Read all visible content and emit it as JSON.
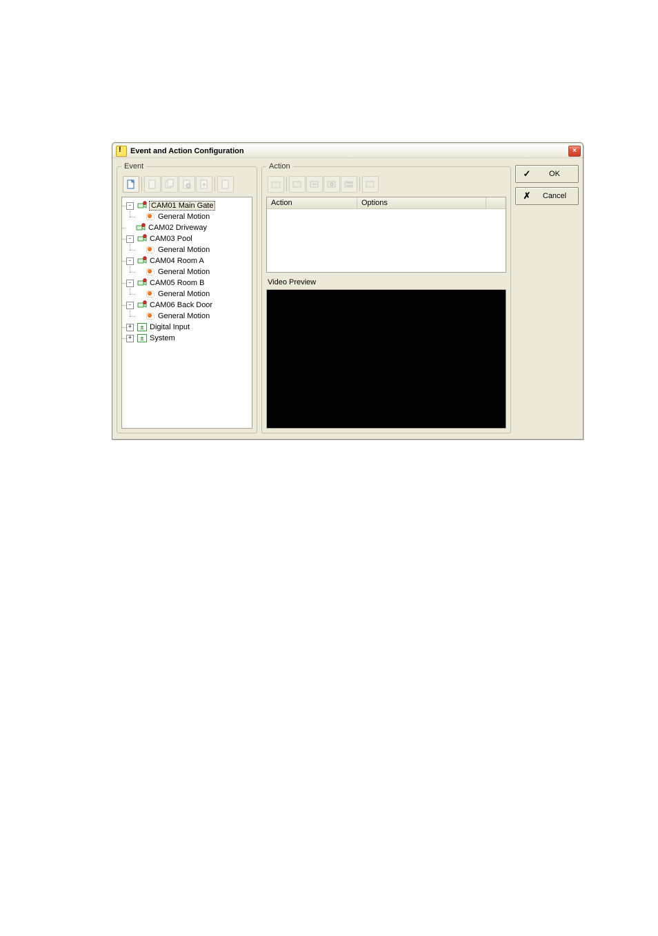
{
  "window": {
    "title": "Event and Action Configuration",
    "close_glyph": "×"
  },
  "event": {
    "legend": "Event",
    "tree": [
      {
        "type": "cam",
        "label": "CAM01 Main Gate",
        "selected": true,
        "expanded": true,
        "children": [
          {
            "type": "motion",
            "label": "General Motion"
          }
        ]
      },
      {
        "type": "cam",
        "label": "CAM02 Driveway",
        "expanded": false,
        "children": []
      },
      {
        "type": "cam",
        "label": "CAM03 Pool",
        "expanded": true,
        "children": [
          {
            "type": "motion",
            "label": "General Motion"
          }
        ]
      },
      {
        "type": "cam",
        "label": "CAM04 Room A",
        "expanded": true,
        "children": [
          {
            "type": "motion",
            "label": "General Motion"
          }
        ]
      },
      {
        "type": "cam",
        "label": "CAM05 Room B",
        "expanded": true,
        "children": [
          {
            "type": "motion",
            "label": "General Motion"
          }
        ]
      },
      {
        "type": "cam",
        "label": "CAM06 Back Door",
        "expanded": true,
        "children": [
          {
            "type": "motion",
            "label": "General Motion"
          }
        ]
      },
      {
        "type": "io",
        "label": "Digital Input",
        "expanded": false,
        "children": []
      },
      {
        "type": "io",
        "label": "System",
        "expanded": false,
        "children": []
      }
    ]
  },
  "action": {
    "legend": "Action",
    "columns": {
      "action": "Action",
      "options": "Options"
    },
    "video_preview_label": "Video Preview"
  },
  "buttons": {
    "ok": "OK",
    "cancel": "Cancel"
  },
  "icons": {
    "cam_rec_dot": "•"
  }
}
